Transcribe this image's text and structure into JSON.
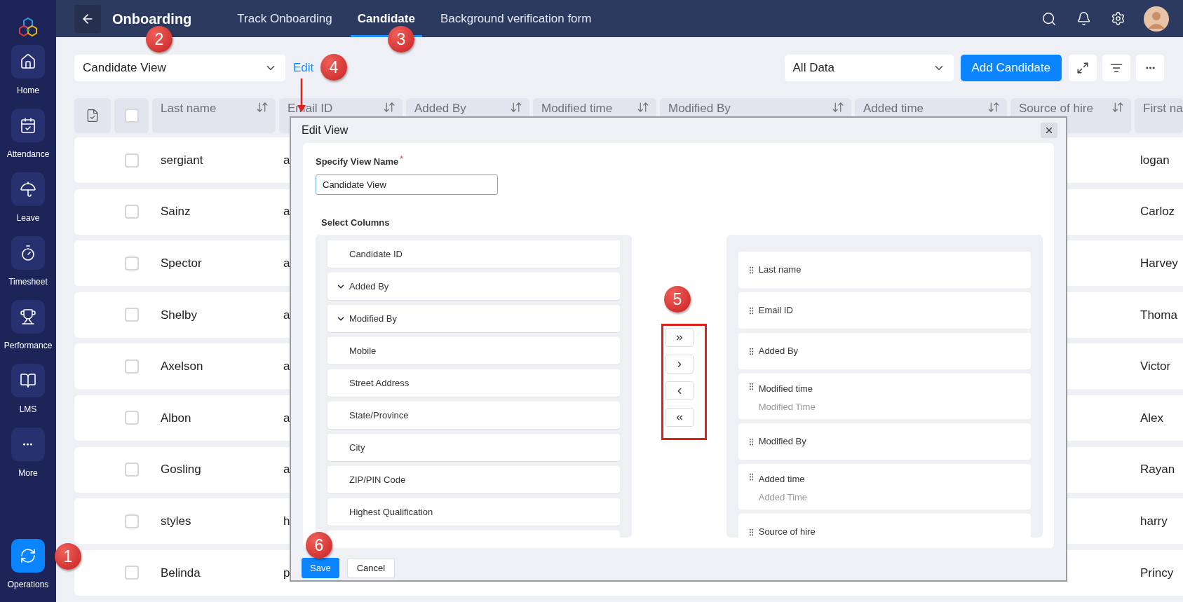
{
  "sidebar": {
    "items": [
      {
        "label": "Home",
        "kind": "home",
        "selected": false
      },
      {
        "label": "Attendance",
        "kind": "calendar",
        "selected": false
      },
      {
        "label": "Leave",
        "kind": "umbrella",
        "selected": false
      },
      {
        "label": "Timesheet",
        "kind": "timer",
        "selected": false
      },
      {
        "label": "Performance",
        "kind": "trophy",
        "selected": false
      },
      {
        "label": "LMS",
        "kind": "book",
        "selected": false
      },
      {
        "label": "More",
        "kind": "more",
        "selected": false
      },
      {
        "label": "Operations",
        "kind": "sync",
        "selected": true
      }
    ]
  },
  "top_bar": {
    "title": "Onboarding",
    "tabs": [
      {
        "label": "Track Onboarding",
        "selected": false
      },
      {
        "label": "Candidate",
        "selected": true
      },
      {
        "label": "Background verification form",
        "selected": false
      }
    ]
  },
  "toolbar": {
    "view_select": "Candidate View",
    "edit_link": "Edit",
    "data_select": "All Data",
    "add_button": "Add Candidate"
  },
  "table": {
    "select_all_checked": false,
    "columns": [
      {
        "label": "Last name"
      },
      {
        "label": "Email ID"
      },
      {
        "label": "Added By"
      },
      {
        "label": "Modified time"
      },
      {
        "label": "Modified By"
      },
      {
        "label": "Added time"
      },
      {
        "label": "Source of hire"
      },
      {
        "label": "First na"
      }
    ],
    "rows": [
      {
        "checked": false,
        "last_name": "sergiant",
        "email": "a",
        "first_name": "logan"
      },
      {
        "checked": false,
        "last_name": "Sainz",
        "email": "a",
        "first_name": "Carloz"
      },
      {
        "checked": false,
        "last_name": "Spector",
        "email": "a",
        "first_name": "Harvey"
      },
      {
        "checked": false,
        "last_name": "Shelby",
        "email": "a",
        "first_name": "Thoma"
      },
      {
        "checked": false,
        "last_name": "Axelson",
        "email": "a",
        "first_name": "Victor"
      },
      {
        "checked": false,
        "last_name": "Albon",
        "email": "a",
        "first_name": "Alex"
      },
      {
        "checked": false,
        "last_name": "Gosling",
        "email": "a",
        "first_name": "Rayan"
      },
      {
        "checked": false,
        "last_name": "styles",
        "email": "h",
        "first_name": "harry"
      },
      {
        "checked": false,
        "last_name": "Belinda",
        "email": "p",
        "first_name": "Princy"
      }
    ]
  },
  "modal": {
    "title": "Edit View",
    "name_label": "Specify View Name",
    "required_mark": "*",
    "name_value": "Candidate View",
    "columns_label": "Select Columns",
    "available": [
      {
        "label": "Candidate ID",
        "kind": "field"
      },
      {
        "label": "Added By",
        "kind": "group"
      },
      {
        "label": "Modified By",
        "kind": "group"
      },
      {
        "label": "Mobile",
        "kind": "field"
      },
      {
        "label": "Street Address",
        "kind": "field"
      },
      {
        "label": "State/Province",
        "kind": "field"
      },
      {
        "label": "City",
        "kind": "field"
      },
      {
        "label": "ZIP/PIN Code",
        "kind": "field"
      },
      {
        "label": "Highest Qualification",
        "kind": "field"
      }
    ],
    "move_buttons": [
      {
        "kind": "add_all"
      },
      {
        "kind": "add"
      },
      {
        "kind": "remove"
      },
      {
        "kind": "remove_all"
      }
    ],
    "chosen": [
      {
        "label": "Last name"
      },
      {
        "label": "Email ID"
      },
      {
        "label": "Added By"
      },
      {
        "label": "Modified time",
        "sub": "Modified Time"
      },
      {
        "label": "Modified By"
      },
      {
        "label": "Added time",
        "sub": "Added Time"
      },
      {
        "label": "Source of hire"
      }
    ],
    "save": "Save",
    "cancel": "Cancel"
  },
  "callouts": [
    "1",
    "2",
    "3",
    "4",
    "5",
    "6"
  ]
}
